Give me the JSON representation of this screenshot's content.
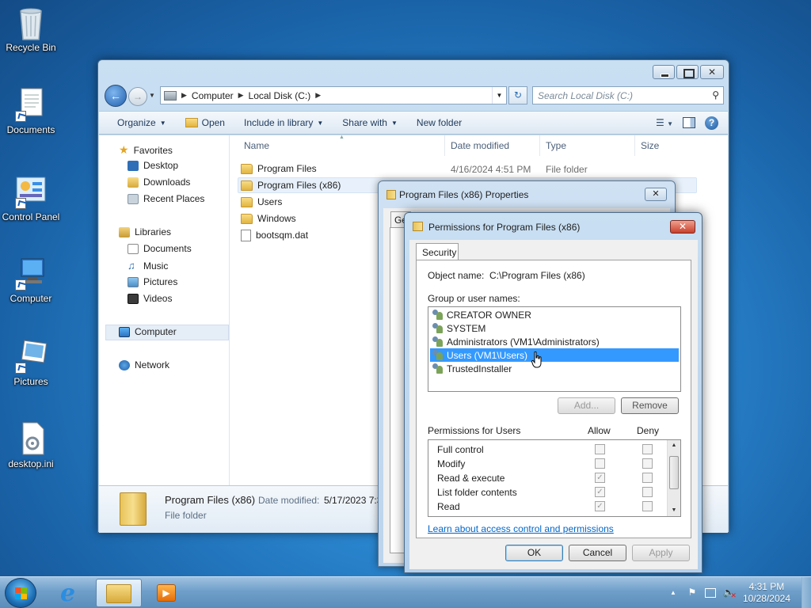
{
  "desktop": {
    "icons": [
      {
        "label": "Recycle Bin"
      },
      {
        "label": "Documents"
      },
      {
        "label": "Control Panel"
      },
      {
        "label": "Computer"
      },
      {
        "label": "Pictures"
      },
      {
        "label": "desktop.ini"
      }
    ]
  },
  "explorer": {
    "breadcrumb": [
      "Computer",
      "Local Disk (C:)"
    ],
    "search_placeholder": "Search Local Disk (C:)",
    "toolbar": {
      "organize": "Organize",
      "open": "Open",
      "include_in_library": "Include in library",
      "share_with": "Share with",
      "new_folder": "New folder"
    },
    "nav": {
      "favorites": "Favorites",
      "favorites_items": [
        "Desktop",
        "Downloads",
        "Recent Places"
      ],
      "libraries": "Libraries",
      "libraries_items": [
        "Documents",
        "Music",
        "Pictures",
        "Videos"
      ],
      "computer": "Computer",
      "network": "Network"
    },
    "columns": {
      "name": "Name",
      "date_modified": "Date modified",
      "type": "Type",
      "size": "Size"
    },
    "files": [
      {
        "name": "Program Files",
        "date": "4/16/2024 4:51 PM",
        "type": "File folder"
      },
      {
        "name": "Program Files (x86)",
        "date": "",
        "type": ""
      },
      {
        "name": "Users",
        "date": "",
        "type": ""
      },
      {
        "name": "Windows",
        "date": "",
        "type": ""
      },
      {
        "name": "bootsqm.dat",
        "date": "",
        "type": ""
      }
    ],
    "details": {
      "name": "Program Files (x86)",
      "date_label": "Date modified:",
      "date_value": "5/17/2023 7:3",
      "type": "File folder"
    }
  },
  "properties_dialog": {
    "title": "Program Files (x86) Properties",
    "fragments": {
      "tab": "Ge",
      "c1": "C",
      "g": "G",
      "t": "T",
      "f1": "F",
      "c2": "C",
      "f2": "F",
      "c3": "C",
      "l": "L"
    }
  },
  "permissions_dialog": {
    "title": "Permissions for Program Files (x86)",
    "tab": "Security",
    "object_name_label": "Object name:",
    "object_name_value": "C:\\Program Files (x86)",
    "group_label": "Group or user names:",
    "users": [
      {
        "name": "CREATOR OWNER",
        "selected": false
      },
      {
        "name": "SYSTEM",
        "selected": false
      },
      {
        "name": "Administrators (VM1\\Administrators)",
        "selected": false
      },
      {
        "name": "Users (VM1\\Users)",
        "selected": true
      },
      {
        "name": "TrustedInstaller",
        "selected": false
      }
    ],
    "add_button": "Add...",
    "remove_button": "Remove",
    "permissions_for": "Permissions for Users",
    "allow_label": "Allow",
    "deny_label": "Deny",
    "permissions": [
      {
        "name": "Full control",
        "allow": false,
        "deny": false
      },
      {
        "name": "Modify",
        "allow": false,
        "deny": false
      },
      {
        "name": "Read & execute",
        "allow": true,
        "deny": false
      },
      {
        "name": "List folder contents",
        "allow": true,
        "deny": false
      },
      {
        "name": "Read",
        "allow": true,
        "deny": false
      }
    ],
    "link": "Learn about access control and permissions",
    "ok": "OK",
    "cancel": "Cancel",
    "apply": "Apply"
  },
  "taskbar": {
    "time": "4:31 PM",
    "date": "10/28/2024"
  }
}
